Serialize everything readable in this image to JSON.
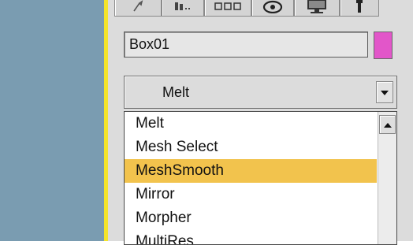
{
  "object": {
    "name": "Box01",
    "color": "#e256c9"
  },
  "tabs": [
    {
      "icon": "create-icon"
    },
    {
      "icon": "modify-icon"
    },
    {
      "icon": "hierarchy-icon"
    },
    {
      "icon": "motion-icon"
    },
    {
      "icon": "display-icon"
    },
    {
      "icon": "utilities-icon"
    }
  ],
  "modifier_list": {
    "selected": "Melt",
    "items": [
      {
        "label": "Melt"
      },
      {
        "label": "Mesh Select"
      },
      {
        "label": "MeshSmooth",
        "highlighted": true
      },
      {
        "label": "Mirror"
      },
      {
        "label": "Morpher"
      },
      {
        "label": "MultiRes"
      }
    ]
  },
  "colors": {
    "viewport": "#7a9cb1",
    "viewport_border": "#f4e42a",
    "panel": "#dcdcdc",
    "highlight": "#f2c34d"
  }
}
